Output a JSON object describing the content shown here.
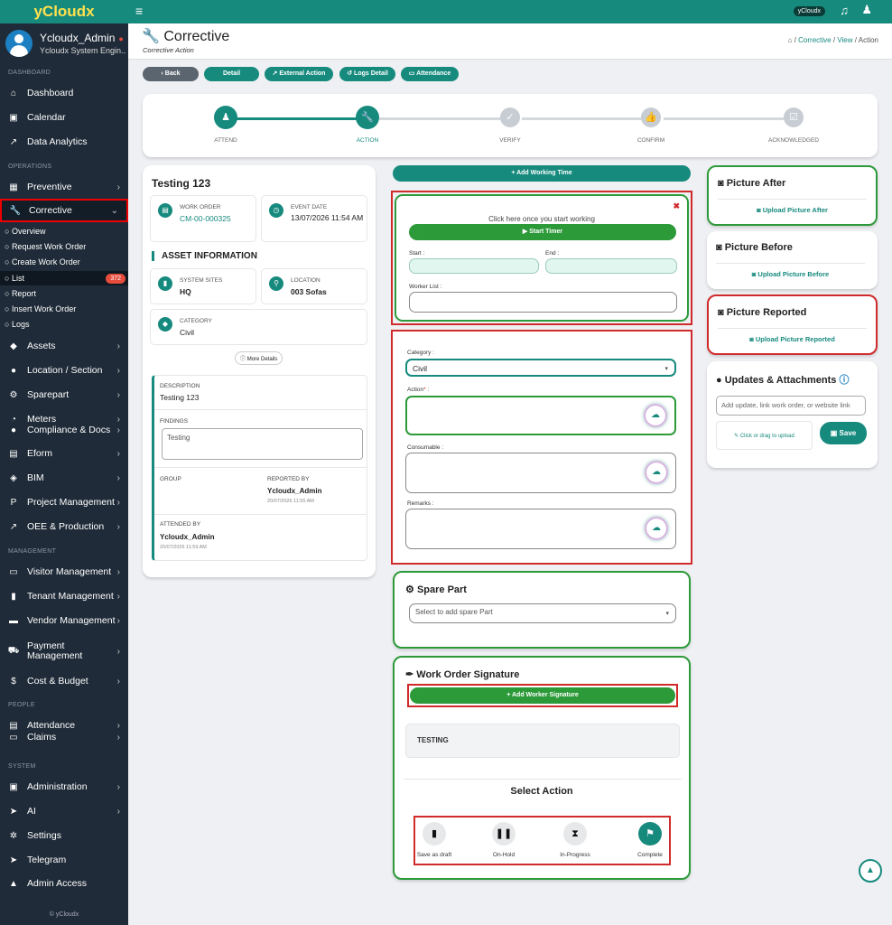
{
  "brand": "yCloudx",
  "user": {
    "name": "Ycloudx_Admin",
    "role": "Ycloudx System Engin..."
  },
  "sidebar": {
    "sections": {
      "dashboard": "DASHBOARD",
      "operations": "OPERATIONS",
      "management": "MANAGEMENT",
      "people": "PEOPLE",
      "system": "SYSTEM"
    },
    "items": {
      "dashboard": "Dashboard",
      "calendar": "Calendar",
      "data_analytics": "Data Analytics",
      "preventive": "Preventive",
      "corrective": "Corrective",
      "assets": "Assets",
      "location": "Location / Section",
      "sparepart": "Sparepart",
      "meters": "Meters",
      "compliance": "Compliance & Docs",
      "eform": "Eform",
      "bim": "BIM",
      "project": "Project Management",
      "oee": "OEE & Production",
      "visitor": "Visitor Management",
      "tenant": "Tenant Management",
      "vendor": "Vendor Management",
      "payment": "Payment Management",
      "cost": "Cost & Budget",
      "attendance": "Attendance",
      "claims": "Claims",
      "administration": "Administration",
      "ai": "AI",
      "settings": "Settings",
      "telegram": "Telegram",
      "admin_access": "Admin Access"
    },
    "corrective_sub": [
      "Overview",
      "Request Work Order",
      "Create Work Order",
      "List",
      "Report",
      "Insert Work Order",
      "Logs"
    ],
    "list_badge": "372",
    "copyright": "© yCloudx"
  },
  "topbar": {
    "chip": "yCloudx"
  },
  "header": {
    "title": "Corrective",
    "subtitle": "Corrective Action",
    "crumb1": "Corrective",
    "crumb2": "View",
    "crumb3": "Action",
    "sep": "/"
  },
  "actions": {
    "back": "Back",
    "detail": "Detail",
    "external": "External Action",
    "logs": "Logs Detail",
    "attendance": "Attendance"
  },
  "steps": [
    "ATTEND",
    "ACTION",
    "VERIFY",
    "CONFIRM",
    "ACKNOWLEDGED"
  ],
  "left": {
    "title": "Testing 123",
    "wo_label": "WORK ORDER",
    "wo_value": "CM-00-000325",
    "event_label": "EVENT DATE",
    "event_value": "13/07/2026 11:54 AM",
    "asset_header": "ASSET INFORMATION",
    "site_label": "SYSTEM SITES",
    "site_value": "HQ",
    "loc_label": "LOCATION",
    "loc_value": "003 Sofas",
    "cat_label": "CATEGORY",
    "cat_value": "Civil",
    "more": "More Details",
    "desc_label": "DESCRIPTION",
    "desc_value": "Testing 123",
    "findings_label": "FINDINGS",
    "findings_value": "Testing",
    "group_label": "GROUP",
    "reported_label": "REPORTED BY",
    "reported_value": "Ycloudx_Admin",
    "reported_date": "20/07/2026 11:55 AM",
    "attended_label": "ATTENDED BY",
    "attended_value": "Ycloudx_Admin",
    "attended_date": "20/07/2026 11:59 AM"
  },
  "timer": {
    "add_working": "Add Working Time",
    "hint": "Click here once you start working",
    "start_timer": "Start Timer",
    "start_label": "Start :",
    "end_label": "End :",
    "worker_label": "Worker List :"
  },
  "form": {
    "category_label": "Category :",
    "category_value": "Civil",
    "action_label": "Action",
    "required_mark": "*",
    "colon": " :",
    "consumable_label": "Consumable :",
    "remarks_label": "Remarks :"
  },
  "spare": {
    "title": "Spare Part",
    "placeholder": "Select to add spare Part"
  },
  "signature": {
    "title": "Work Order Signature",
    "add_btn": "Add Worker Signature",
    "text": "TESTING",
    "select_action": "Select Action"
  },
  "select_actions": [
    "Save as draft",
    "On-Hold",
    "In-Progress",
    "Complete"
  ],
  "pictures": {
    "after_title": "Picture After",
    "after_link": "Upload Picture After",
    "before_title": "Picture Before",
    "before_link": "Upload Picture Before",
    "reported_title": "Picture Reported",
    "reported_link": "Upload Picture Reported"
  },
  "updates": {
    "title": "Updates & Attachments",
    "placeholder": "Add update, link work order, or website link",
    "drop": "Click or drag to upload",
    "save": "Save"
  },
  "colors": {
    "accent": "#178a7e",
    "green": "#2d9a3a",
    "red_outline": "#d02a2a",
    "sidebar": "#1f2b38"
  }
}
